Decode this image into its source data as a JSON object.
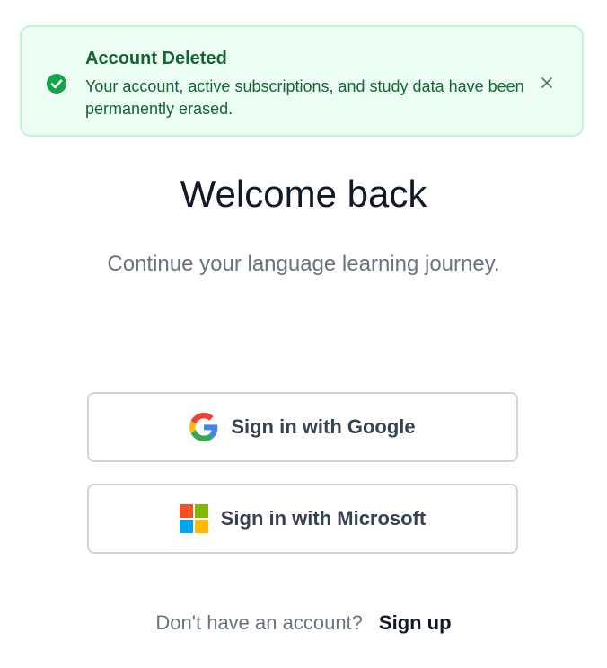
{
  "alert": {
    "icon": "check-circle-icon",
    "title": "Account Deleted",
    "message": "Your account, active subscriptions, and study data have been permanently erased.",
    "close_icon": "close-icon",
    "colors": {
      "background": "#ecfdf3",
      "border": "#bbf7d0",
      "text": "#166534",
      "icon": "#16a34a"
    }
  },
  "heading": {
    "title": "Welcome back",
    "subtitle": "Continue your language learning journey."
  },
  "sso": [
    {
      "provider": "google",
      "icon": "google-logo-icon",
      "label": "Sign in with Google"
    },
    {
      "provider": "microsoft",
      "icon": "microsoft-logo-icon",
      "label": "Sign in with Microsoft"
    }
  ],
  "footer": {
    "prompt": "Don't have an account?",
    "link_label": "Sign up"
  }
}
